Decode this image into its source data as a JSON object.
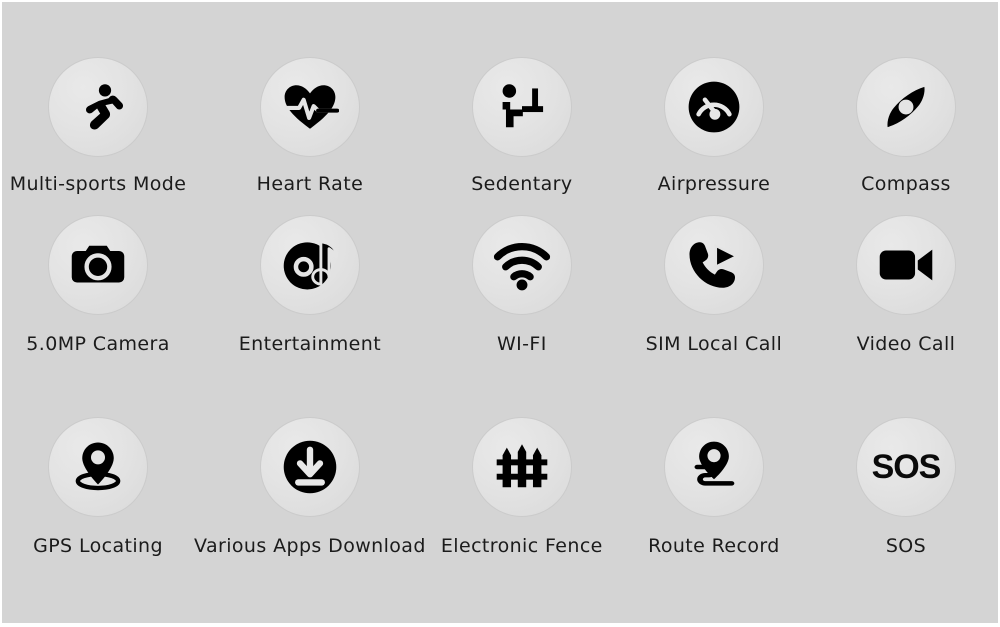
{
  "poster": {
    "background_color": "#d4d4d4",
    "badge_color": "#e4e4e4",
    "icon_color": "#000000",
    "label_color": "#1b1b1b",
    "columns": 5,
    "rows": 3
  },
  "features": [
    {
      "id": "multi-sports-mode",
      "label": "Multi-sports Mode",
      "icon": "running-person-icon",
      "row": 1,
      "col": 1
    },
    {
      "id": "heart-rate",
      "label": "Heart Rate",
      "icon": "heart-pulse-icon",
      "row": 1,
      "col": 2
    },
    {
      "id": "sedentary",
      "label": "Sedentary",
      "icon": "seated-person-desk-icon",
      "row": 1,
      "col": 3
    },
    {
      "id": "airpressure",
      "label": "Airpressure",
      "icon": "gauge-icon",
      "row": 1,
      "col": 4
    },
    {
      "id": "compass",
      "label": "Compass",
      "icon": "compass-needle-icon",
      "row": 1,
      "col": 5
    },
    {
      "id": "camera",
      "label": "5.0MP Camera",
      "icon": "camera-icon",
      "row": 2,
      "col": 1
    },
    {
      "id": "entertainment",
      "label": "Entertainment",
      "icon": "disc-music-note-icon",
      "row": 2,
      "col": 2
    },
    {
      "id": "wifi",
      "label": "WI-FI",
      "icon": "wifi-icon",
      "row": 2,
      "col": 3
    },
    {
      "id": "sim-local-call",
      "label": "SIM Local Call",
      "icon": "phone-outgoing-icon",
      "row": 2,
      "col": 4
    },
    {
      "id": "video-call",
      "label": "Video Call",
      "icon": "video-camera-icon",
      "row": 2,
      "col": 5
    },
    {
      "id": "gps-locating",
      "label": "GPS Locating",
      "icon": "map-pin-ring-icon",
      "row": 3,
      "col": 1
    },
    {
      "id": "various-apps-download",
      "label": "Various Apps Download",
      "icon": "download-circle-icon",
      "row": 3,
      "col": 2
    },
    {
      "id": "electronic-fence",
      "label": "Electronic Fence",
      "icon": "picket-fence-icon",
      "row": 3,
      "col": 3
    },
    {
      "id": "route-record",
      "label": "Route Record",
      "icon": "route-pin-path-icon",
      "row": 3,
      "col": 4
    },
    {
      "id": "sos",
      "label": "SOS",
      "icon": "sos-text-icon",
      "icon_text": "SOS",
      "row": 3,
      "col": 5
    }
  ]
}
